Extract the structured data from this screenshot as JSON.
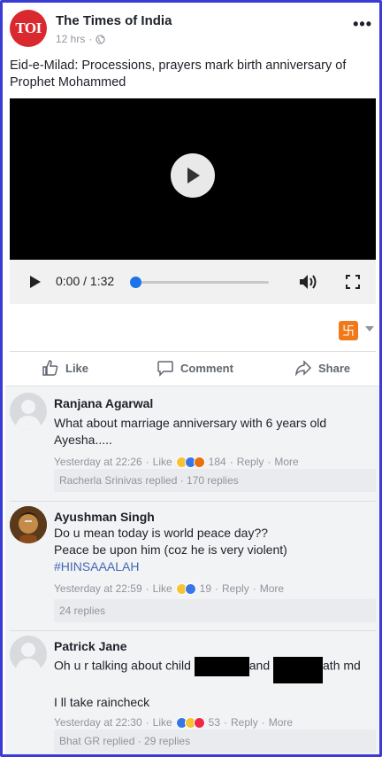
{
  "post": {
    "page_logo_text": "TOI",
    "page_name": "The Times of India",
    "time": "12 hrs",
    "text": "Eid-e-Milad: Processions, prayers mark birth anniversary of Prophet Mohammed"
  },
  "video": {
    "time_display": "0:00 / 1:32",
    "progress": 0
  },
  "actions": {
    "like": "Like",
    "comment": "Comment",
    "share": "Share"
  },
  "reaction_picker_glyph": "卐",
  "comments": [
    {
      "name": "Ranjana Agarwal",
      "text": "What about marriage anniversary with 6 years old Ayesha.....",
      "time": "Yesterday at 22:26",
      "like": "Like",
      "reactions": [
        "haha",
        "like",
        "angry"
      ],
      "reaction_count": "184",
      "reply": "Reply",
      "more": "More",
      "replies_summary": "Racherla Srinivas replied · 170 replies"
    },
    {
      "name": "Ayushman Singh",
      "text_line1": "Do u mean today is world peace day??",
      "text_line2": "Peace be upon him (coz he is very violent)",
      "hashtag": "#HINSAAALAH",
      "time": "Yesterday at 22:59",
      "like": "Like",
      "reactions": [
        "haha",
        "like"
      ],
      "reaction_count": "19",
      "reply": "Reply",
      "more": "More",
      "replies_summary": "24 replies"
    },
    {
      "name": "Patrick Jane",
      "text_part1": "Oh u r talking about child",
      "text_part2": "and",
      "text_part3": "ath md",
      "text_line2": "I ll take raincheck",
      "time": "Yesterday at 22:30",
      "like": "Like",
      "reactions": [
        "like",
        "haha",
        "love"
      ],
      "reaction_count": "53",
      "reply": "Reply",
      "more": "More",
      "replies_summary": "Bhat GR replied · 29 replies"
    }
  ],
  "colors": {
    "frame_border": "#3b3bd6",
    "link_blue": "#4267b2",
    "meta_gray": "#90949c",
    "logo_red": "#d9282e",
    "progress_blue": "#1a73e8"
  }
}
